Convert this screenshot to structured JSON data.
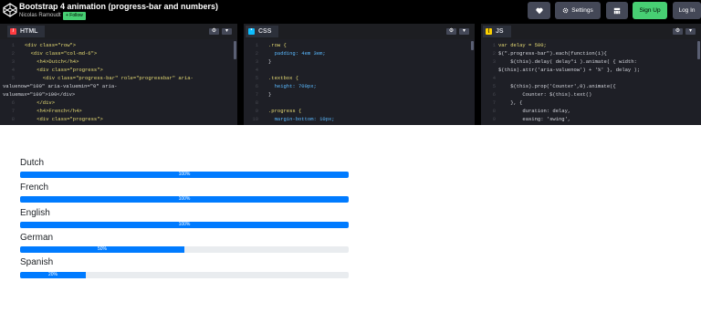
{
  "header": {
    "title": "Bootstrap 4 animation (progress-bar and numbers)",
    "author": "Nicolas Ramoudt",
    "follow_label": "+ Follow",
    "buttons": {
      "settings": "Settings",
      "signup": "Sign Up",
      "login": "Log In"
    },
    "icons": [
      "codepen-logo-icon",
      "heart-icon",
      "gear-icon",
      "layout-icon"
    ]
  },
  "panels": [
    {
      "name": "HTML",
      "icon_color": "#ff3c41",
      "lines": [
        {
          "n": "1",
          "t": "<div class=\"row\">"
        },
        {
          "n": "2",
          "t": "  <div class=\"col-md-6\">"
        },
        {
          "n": "3",
          "t": "    <h4>Dutch</h4>"
        },
        {
          "n": "4",
          "t": "    <div class=\"progress\">"
        },
        {
          "n": "5",
          "t": "      <div class=\"progress-bar\" role=\"progressbar\" aria-"
        },
        {
          "n": "",
          "t": "valuenow=\"100\" aria-valuemin=\"0\" aria-"
        },
        {
          "n": "",
          "t": "valuemax=\"100\">100</div>"
        },
        {
          "n": "6",
          "t": "    </div>"
        },
        {
          "n": "7",
          "t": "    <h4>French</h4>"
        },
        {
          "n": "8",
          "t": "    <div class=\"progress\">"
        }
      ]
    },
    {
      "name": "CSS",
      "icon_color": "#0ebeff",
      "lines": [
        {
          "n": "1",
          "t": ".row {"
        },
        {
          "n": "2",
          "t": "  padding: 4em 3em;"
        },
        {
          "n": "3",
          "t": "}"
        },
        {
          "n": "4",
          "t": ""
        },
        {
          "n": "5",
          "t": ".textbox {"
        },
        {
          "n": "6",
          "t": "  height: 700px;"
        },
        {
          "n": "7",
          "t": "}"
        },
        {
          "n": "8",
          "t": ""
        },
        {
          "n": "9",
          "t": ".progress {"
        },
        {
          "n": "10",
          "t": "  margin-bottom: 10px;"
        }
      ]
    },
    {
      "name": "JS",
      "icon_color": "#fcd000",
      "lines": [
        {
          "n": "1",
          "t": "var delay = 500;"
        },
        {
          "n": "2",
          "t": "$(\".progress-bar\").each(function(i){"
        },
        {
          "n": "3",
          "t": "    $(this).delay( delay*i ).animate( { width:"
        },
        {
          "n": "",
          "t": "$(this).attr('aria-valuenow') + '%' }, delay );"
        },
        {
          "n": "4",
          "t": ""
        },
        {
          "n": "5",
          "t": "    $(this).prop('Counter',0).animate({"
        },
        {
          "n": "6",
          "t": "        Counter: $(this).text()"
        },
        {
          "n": "7",
          "t": "    }, {"
        },
        {
          "n": "8",
          "t": "        duration: delay,"
        },
        {
          "n": "9",
          "t": "        easing: 'swing',"
        }
      ]
    }
  ],
  "result": {
    "bars": [
      {
        "label": "Dutch",
        "value": 100,
        "text": "100%"
      },
      {
        "label": "French",
        "value": 100,
        "text": "100%"
      },
      {
        "label": "English",
        "value": 100,
        "text": "100%"
      },
      {
        "label": "German",
        "value": 50,
        "text": "50%"
      },
      {
        "label": "Spanish",
        "value": 20,
        "text": "20%"
      }
    ]
  },
  "colors": {
    "accent": "#47cf73",
    "progress": "#007bff",
    "track": "#e9ecef"
  }
}
